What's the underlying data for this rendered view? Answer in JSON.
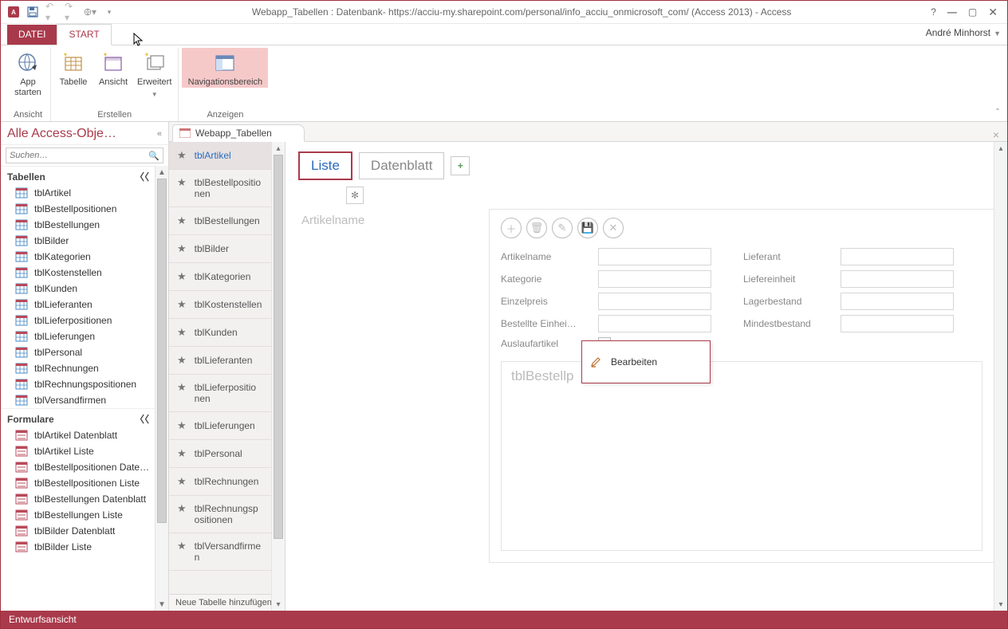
{
  "title": "Webapp_Tabellen : Datenbank- https://acciu-my.sharepoint.com/personal/info_acciu_onmicrosoft_com/ (Access 2013) - Access",
  "user": "André Minhorst",
  "tabs": {
    "file": "DATEI",
    "start": "START"
  },
  "ribbon": {
    "ansicht": {
      "app_starten": "App\nstarten",
      "group": "Ansicht"
    },
    "erstellen": {
      "tabelle": "Tabelle",
      "ansicht": "Ansicht",
      "erweitert": "Erweitert",
      "group": "Erstellen"
    },
    "anzeigen": {
      "nav": "Navigationsbereich",
      "group": "Anzeigen"
    }
  },
  "nav": {
    "title": "Alle Access-Obje…",
    "search_placeholder": "Suchen…",
    "group_tabellen": "Tabellen",
    "group_formulare": "Formulare",
    "tables": [
      "tblArtikel",
      "tblBestellpositionen",
      "tblBestellungen",
      "tblBilder",
      "tblKategorien",
      "tblKostenstellen",
      "tblKunden",
      "tblLieferanten",
      "tblLieferpositionen",
      "tblLieferungen",
      "tblPersonal",
      "tblRechnungen",
      "tblRechnungspositionen",
      "tblVersandfirmen"
    ],
    "forms": [
      "tblArtikel Datenblatt",
      "tblArtikel Liste",
      "tblBestellpositionen Date…",
      "tblBestellpositionen Liste",
      "tblBestellungen Datenblatt",
      "tblBestellungen Liste",
      "tblBilder Datenblatt",
      "tblBilder Liste"
    ]
  },
  "doc": {
    "tab": "Webapp_Tabellen"
  },
  "tlist": {
    "items": [
      "tblArtikel",
      "tblBestellpositionen",
      "tblBestellungen",
      "tblBilder",
      "tblKategorien",
      "tblKostenstellen",
      "tblKunden",
      "tblLieferanten",
      "tblLieferpositionen",
      "tblLieferungen",
      "tblPersonal",
      "tblRechnungen",
      "tblRechnungspositionen",
      "tblVersandfirmen"
    ],
    "add": "Neue Tabelle hinzufügen"
  },
  "views": {
    "liste": "Liste",
    "datenblatt": "Datenblatt"
  },
  "form": {
    "list_placeholder": "Artikelname",
    "left_labels": [
      "Artikelname",
      "Kategorie",
      "Einzelpreis",
      "Bestellte Einhei…",
      "Auslaufartikel"
    ],
    "right_labels": [
      "Lieferant",
      "Liefereinheit",
      "Lagerbestand",
      "Mindestbestand"
    ],
    "sub_placeholder": "tblBestellp"
  },
  "context": {
    "bearbeiten": "Bearbeiten"
  },
  "status": "Entwurfsansicht"
}
